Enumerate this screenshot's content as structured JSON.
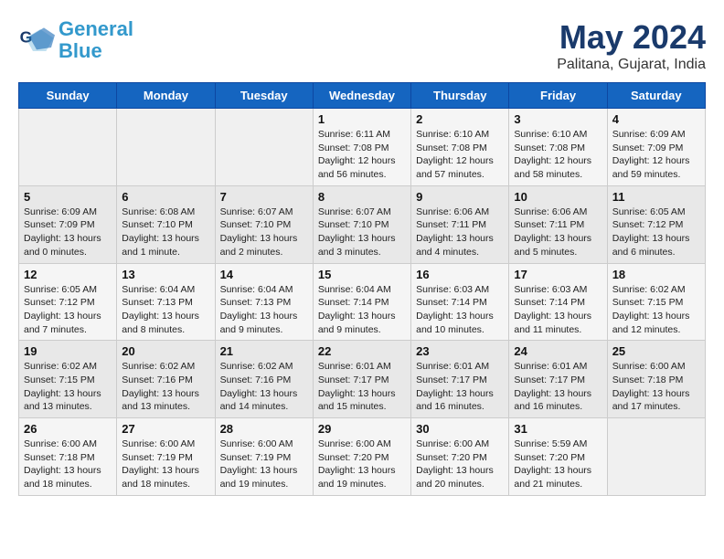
{
  "header": {
    "logo_line1": "General",
    "logo_line2": "Blue",
    "month": "May 2024",
    "location": "Palitana, Gujarat, India"
  },
  "weekdays": [
    "Sunday",
    "Monday",
    "Tuesday",
    "Wednesday",
    "Thursday",
    "Friday",
    "Saturday"
  ],
  "weeks": [
    [
      {
        "day": "",
        "info": ""
      },
      {
        "day": "",
        "info": ""
      },
      {
        "day": "",
        "info": ""
      },
      {
        "day": "1",
        "info": "Sunrise: 6:11 AM\nSunset: 7:08 PM\nDaylight: 12 hours and 56 minutes."
      },
      {
        "day": "2",
        "info": "Sunrise: 6:10 AM\nSunset: 7:08 PM\nDaylight: 12 hours and 57 minutes."
      },
      {
        "day": "3",
        "info": "Sunrise: 6:10 AM\nSunset: 7:08 PM\nDaylight: 12 hours and 58 minutes."
      },
      {
        "day": "4",
        "info": "Sunrise: 6:09 AM\nSunset: 7:09 PM\nDaylight: 12 hours and 59 minutes."
      }
    ],
    [
      {
        "day": "5",
        "info": "Sunrise: 6:09 AM\nSunset: 7:09 PM\nDaylight: 13 hours and 0 minutes."
      },
      {
        "day": "6",
        "info": "Sunrise: 6:08 AM\nSunset: 7:10 PM\nDaylight: 13 hours and 1 minute."
      },
      {
        "day": "7",
        "info": "Sunrise: 6:07 AM\nSunset: 7:10 PM\nDaylight: 13 hours and 2 minutes."
      },
      {
        "day": "8",
        "info": "Sunrise: 6:07 AM\nSunset: 7:10 PM\nDaylight: 13 hours and 3 minutes."
      },
      {
        "day": "9",
        "info": "Sunrise: 6:06 AM\nSunset: 7:11 PM\nDaylight: 13 hours and 4 minutes."
      },
      {
        "day": "10",
        "info": "Sunrise: 6:06 AM\nSunset: 7:11 PM\nDaylight: 13 hours and 5 minutes."
      },
      {
        "day": "11",
        "info": "Sunrise: 6:05 AM\nSunset: 7:12 PM\nDaylight: 13 hours and 6 minutes."
      }
    ],
    [
      {
        "day": "12",
        "info": "Sunrise: 6:05 AM\nSunset: 7:12 PM\nDaylight: 13 hours and 7 minutes."
      },
      {
        "day": "13",
        "info": "Sunrise: 6:04 AM\nSunset: 7:13 PM\nDaylight: 13 hours and 8 minutes."
      },
      {
        "day": "14",
        "info": "Sunrise: 6:04 AM\nSunset: 7:13 PM\nDaylight: 13 hours and 9 minutes."
      },
      {
        "day": "15",
        "info": "Sunrise: 6:04 AM\nSunset: 7:14 PM\nDaylight: 13 hours and 9 minutes."
      },
      {
        "day": "16",
        "info": "Sunrise: 6:03 AM\nSunset: 7:14 PM\nDaylight: 13 hours and 10 minutes."
      },
      {
        "day": "17",
        "info": "Sunrise: 6:03 AM\nSunset: 7:14 PM\nDaylight: 13 hours and 11 minutes."
      },
      {
        "day": "18",
        "info": "Sunrise: 6:02 AM\nSunset: 7:15 PM\nDaylight: 13 hours and 12 minutes."
      }
    ],
    [
      {
        "day": "19",
        "info": "Sunrise: 6:02 AM\nSunset: 7:15 PM\nDaylight: 13 hours and 13 minutes."
      },
      {
        "day": "20",
        "info": "Sunrise: 6:02 AM\nSunset: 7:16 PM\nDaylight: 13 hours and 13 minutes."
      },
      {
        "day": "21",
        "info": "Sunrise: 6:02 AM\nSunset: 7:16 PM\nDaylight: 13 hours and 14 minutes."
      },
      {
        "day": "22",
        "info": "Sunrise: 6:01 AM\nSunset: 7:17 PM\nDaylight: 13 hours and 15 minutes."
      },
      {
        "day": "23",
        "info": "Sunrise: 6:01 AM\nSunset: 7:17 PM\nDaylight: 13 hours and 16 minutes."
      },
      {
        "day": "24",
        "info": "Sunrise: 6:01 AM\nSunset: 7:17 PM\nDaylight: 13 hours and 16 minutes."
      },
      {
        "day": "25",
        "info": "Sunrise: 6:00 AM\nSunset: 7:18 PM\nDaylight: 13 hours and 17 minutes."
      }
    ],
    [
      {
        "day": "26",
        "info": "Sunrise: 6:00 AM\nSunset: 7:18 PM\nDaylight: 13 hours and 18 minutes."
      },
      {
        "day": "27",
        "info": "Sunrise: 6:00 AM\nSunset: 7:19 PM\nDaylight: 13 hours and 18 minutes."
      },
      {
        "day": "28",
        "info": "Sunrise: 6:00 AM\nSunset: 7:19 PM\nDaylight: 13 hours and 19 minutes."
      },
      {
        "day": "29",
        "info": "Sunrise: 6:00 AM\nSunset: 7:20 PM\nDaylight: 13 hours and 19 minutes."
      },
      {
        "day": "30",
        "info": "Sunrise: 6:00 AM\nSunset: 7:20 PM\nDaylight: 13 hours and 20 minutes."
      },
      {
        "day": "31",
        "info": "Sunrise: 5:59 AM\nSunset: 7:20 PM\nDaylight: 13 hours and 21 minutes."
      },
      {
        "day": "",
        "info": ""
      }
    ]
  ]
}
